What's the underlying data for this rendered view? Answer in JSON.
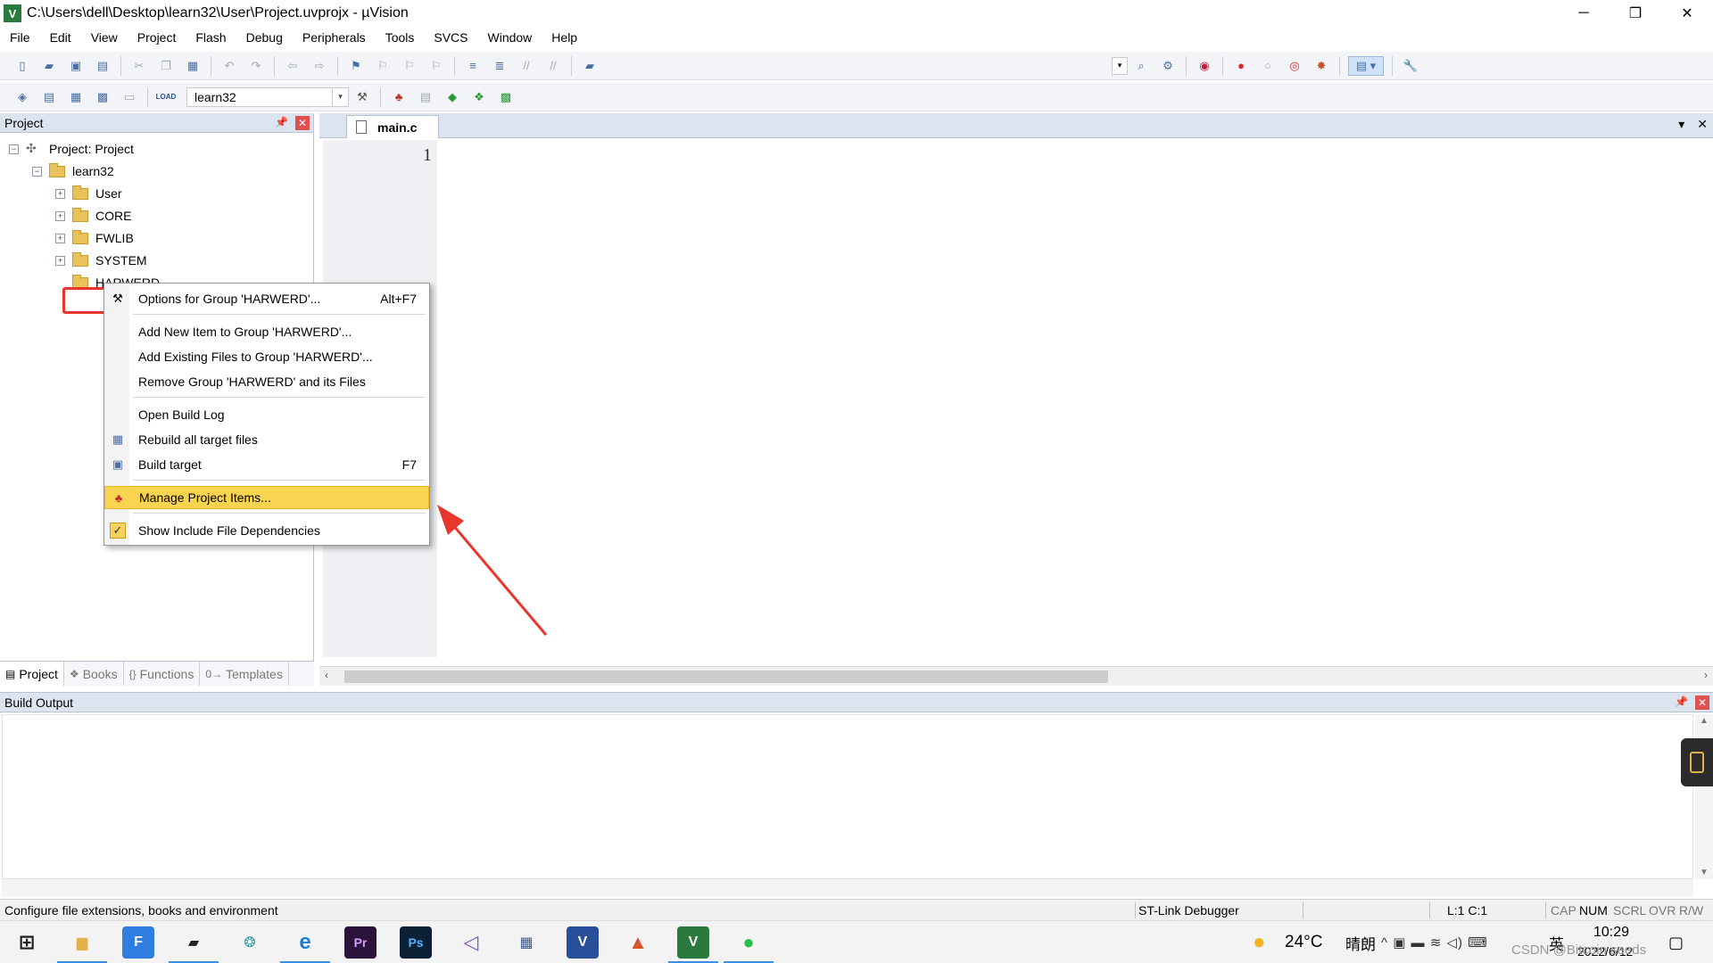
{
  "window": {
    "app_icon_letter": "V",
    "title": "C:\\Users\\dell\\Desktop\\learn32\\User\\Project.uvprojx - µVision",
    "controls": {
      "minimize": "─",
      "restore": "❐",
      "close": "✕"
    }
  },
  "menu": [
    "File",
    "Edit",
    "View",
    "Project",
    "Flash",
    "Debug",
    "Peripherals",
    "Tools",
    "SVCS",
    "Window",
    "Help"
  ],
  "toolbar2": {
    "target_value": "learn32",
    "dropdown_arrow": "▾",
    "load_label": "LOAD"
  },
  "project_panel": {
    "title": "Project",
    "pin": "📌",
    "close": "✕",
    "root": "Project: Project",
    "target": "learn32",
    "groups": [
      "User",
      "CORE",
      "FWLIB",
      "SYSTEM",
      "HARWERD"
    ],
    "expand_plus": "+",
    "expand_minus": "−",
    "tabs": [
      {
        "label": "Project",
        "icon": "▤"
      },
      {
        "label": "Books",
        "icon": "❖"
      },
      {
        "label": "Functions",
        "icon": "{}"
      },
      {
        "label": "Templates",
        "icon": "0→"
      }
    ]
  },
  "editor": {
    "tab": "main.c",
    "line_number": "1",
    "ctrl_dropdown": "▾",
    "ctrl_close": "✕"
  },
  "context_menu": {
    "items": [
      {
        "label": "Options for Group 'HARWERD'...",
        "shortcut": "Alt+F7",
        "icon": "⚒"
      },
      {
        "label": "Add New  Item to Group 'HARWERD'...",
        "shortcut": "",
        "icon": ""
      },
      {
        "label": "Add Existing Files to Group 'HARWERD'...",
        "shortcut": "",
        "icon": ""
      },
      {
        "label": "Remove Group 'HARWERD' and its Files",
        "shortcut": "",
        "icon": ""
      },
      {
        "label": "Open Build Log",
        "shortcut": "",
        "icon": ""
      },
      {
        "label": "Rebuild all target files",
        "shortcut": "",
        "icon": "▦"
      },
      {
        "label": "Build target",
        "shortcut": "F7",
        "icon": "▣"
      },
      {
        "label": "Manage Project Items...",
        "shortcut": "",
        "icon": "♣"
      },
      {
        "label": "Show Include File Dependencies",
        "shortcut": "",
        "icon": "✓"
      }
    ]
  },
  "build_output": {
    "title": "Build Output",
    "pin": "📌",
    "close": "✕"
  },
  "status_bar": {
    "message": "Configure file extensions, books and environment",
    "debugger": "ST-Link Debugger",
    "position": "L:1 C:1",
    "cap": "CAP",
    "num": "NUM",
    "scrl": "SCRL",
    "ovr": "OVR",
    "rw": "R/W"
  },
  "taskbar": {
    "start": "⊞",
    "apps": [
      {
        "name": "file-explorer",
        "glyph": "▆"
      },
      {
        "name": "foxit",
        "glyph": "F"
      },
      {
        "name": "sticky",
        "glyph": "▰"
      },
      {
        "name": "recycle",
        "glyph": "❂"
      },
      {
        "name": "edge",
        "glyph": "e"
      },
      {
        "name": "premiere",
        "glyph": "Pr"
      },
      {
        "name": "photoshop",
        "glyph": "Ps"
      },
      {
        "name": "visual-studio",
        "glyph": "◁"
      },
      {
        "name": "calculator",
        "glyph": "▦"
      },
      {
        "name": "vivado",
        "glyph": "V"
      },
      {
        "name": "matlab",
        "glyph": "▲"
      },
      {
        "name": "keil",
        "glyph": "V"
      },
      {
        "name": "wechat",
        "glyph": "●"
      }
    ],
    "weather_icon": "●",
    "temperature": "24°C",
    "weather": "晴朗",
    "tray_glyphs": "^  ▣  ▬  ≋  ◁)  ⌨",
    "ime": "英",
    "time": "10:29",
    "date": "2022/6/12",
    "watermark": "CSDN @Bitcoin seeds",
    "notifications": "▢"
  },
  "colors": {
    "accent_highlight": "#f9d451",
    "annotation_red": "#e8362d",
    "panel_title_bg": "#dce4f0"
  }
}
